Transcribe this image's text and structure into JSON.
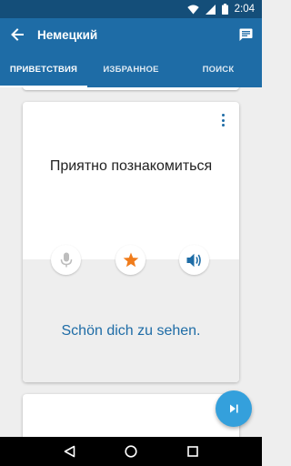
{
  "status_bar": {
    "time": "2:04"
  },
  "app_bar": {
    "title": "Немецкий"
  },
  "tabs": [
    {
      "label": "ПРИВЕТСТВИЯ",
      "active": true
    },
    {
      "label": "ИЗБРАННОЕ",
      "active": false
    },
    {
      "label": "ПОИСК",
      "active": false
    }
  ],
  "card": {
    "phrase": "Приятно познакомиться",
    "translation": "Schön dich zu sehen.",
    "actions": [
      {
        "name": "microphone-icon",
        "color": "#bdbdbd"
      },
      {
        "name": "star-icon",
        "color": "#f07c1b"
      },
      {
        "name": "speaker-icon",
        "color": "#1e6ca6"
      }
    ]
  },
  "colors": {
    "primary": "#1e6ca6",
    "primary_dark": "#144e79",
    "accent": "#f07c1b",
    "fab": "#34a0dc"
  }
}
